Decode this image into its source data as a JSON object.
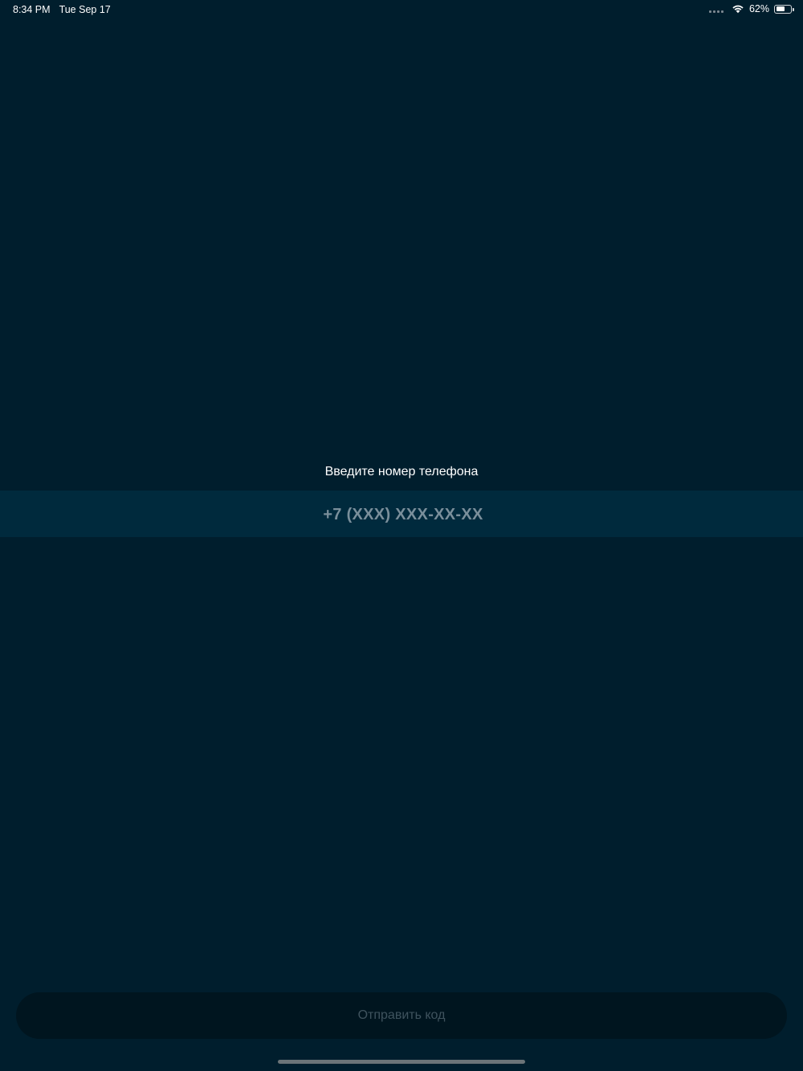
{
  "status_bar": {
    "time": "8:34 PM",
    "date": "Tue Sep 17",
    "battery_text": "62%",
    "battery_level": 0.62,
    "wifi_icon": "wifi-icon",
    "signal_icon": "cellular-signal-icon"
  },
  "login": {
    "phone_label": "Введите номер телефона",
    "phone_placeholder": "+7 (XXX) XXX-XX-XX",
    "phone_value": "",
    "send_button_label": "Отправить код"
  },
  "colors": {
    "background": "#001e2d",
    "input_background": "#002a3d",
    "placeholder": "#7a8f9b",
    "button_background": "#00151f",
    "button_text_disabled": "#3f535e"
  }
}
